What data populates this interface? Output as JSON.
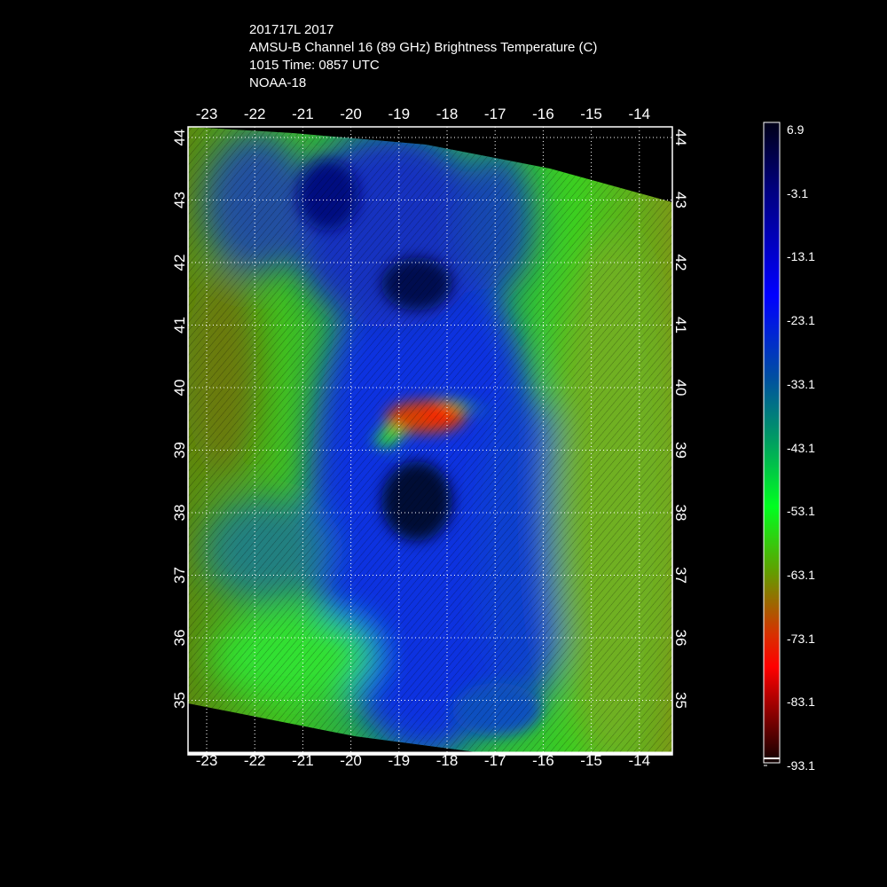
{
  "title": {
    "line1": "201717L 2017",
    "line2": "AMSU-B Channel 16 (89 GHz) Brightness Temperature (C)",
    "line3": "1015 Time: 0857 UTC",
    "line4": "NOAA-18"
  },
  "map": {
    "lon_ticks": [
      "-23",
      "-22",
      "-21",
      "-20",
      "-19",
      "-18",
      "-17",
      "-16",
      "-15",
      "-14"
    ],
    "lat_ticks": [
      "44",
      "43",
      "42",
      "41",
      "40",
      "39",
      "38",
      "37",
      "36",
      "35"
    ],
    "colors": {
      "deep": "#000a2a",
      "blue": "#0000ff",
      "teal": "#00897a",
      "green": "#00ff10",
      "olive": "#6a8a00",
      "red": "#ff1000"
    }
  },
  "colorbar": {
    "labels": [
      "6.9",
      "-3.1",
      "-13.1",
      "-23.1",
      "-33.1",
      "-43.1",
      "-53.1",
      "-63.1",
      "-73.1",
      "-83.1",
      "-93.1"
    ]
  }
}
